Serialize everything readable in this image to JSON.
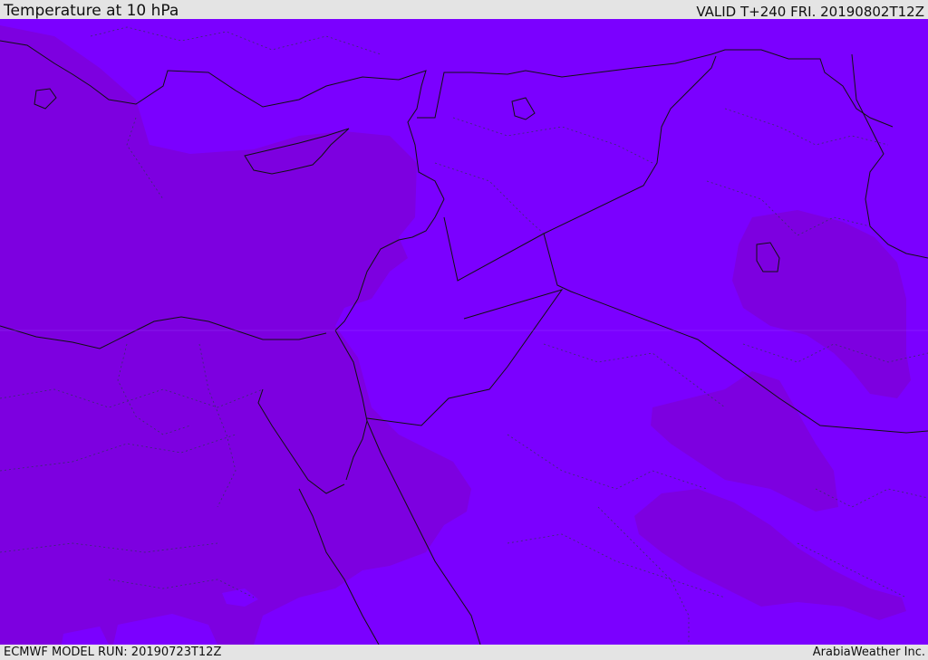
{
  "header": {
    "title": "Temperature at 10 hPa",
    "valid_time": "VALID T+240 FRI. 20190802T12Z"
  },
  "footer": {
    "model_run": "ECMWF MODEL RUN: 20190723T12Z",
    "credit": "ArabiaWeather Inc."
  },
  "map": {
    "field": "temperature",
    "level": "10 hPa",
    "colors": {
      "field_light": "#7b00ff",
      "field_dark": "#7d00e0",
      "field_mid": "#7800ef",
      "border": "#111111",
      "admin_border": "#3a2c6e"
    },
    "region": "Eastern Mediterranean / Middle East"
  }
}
